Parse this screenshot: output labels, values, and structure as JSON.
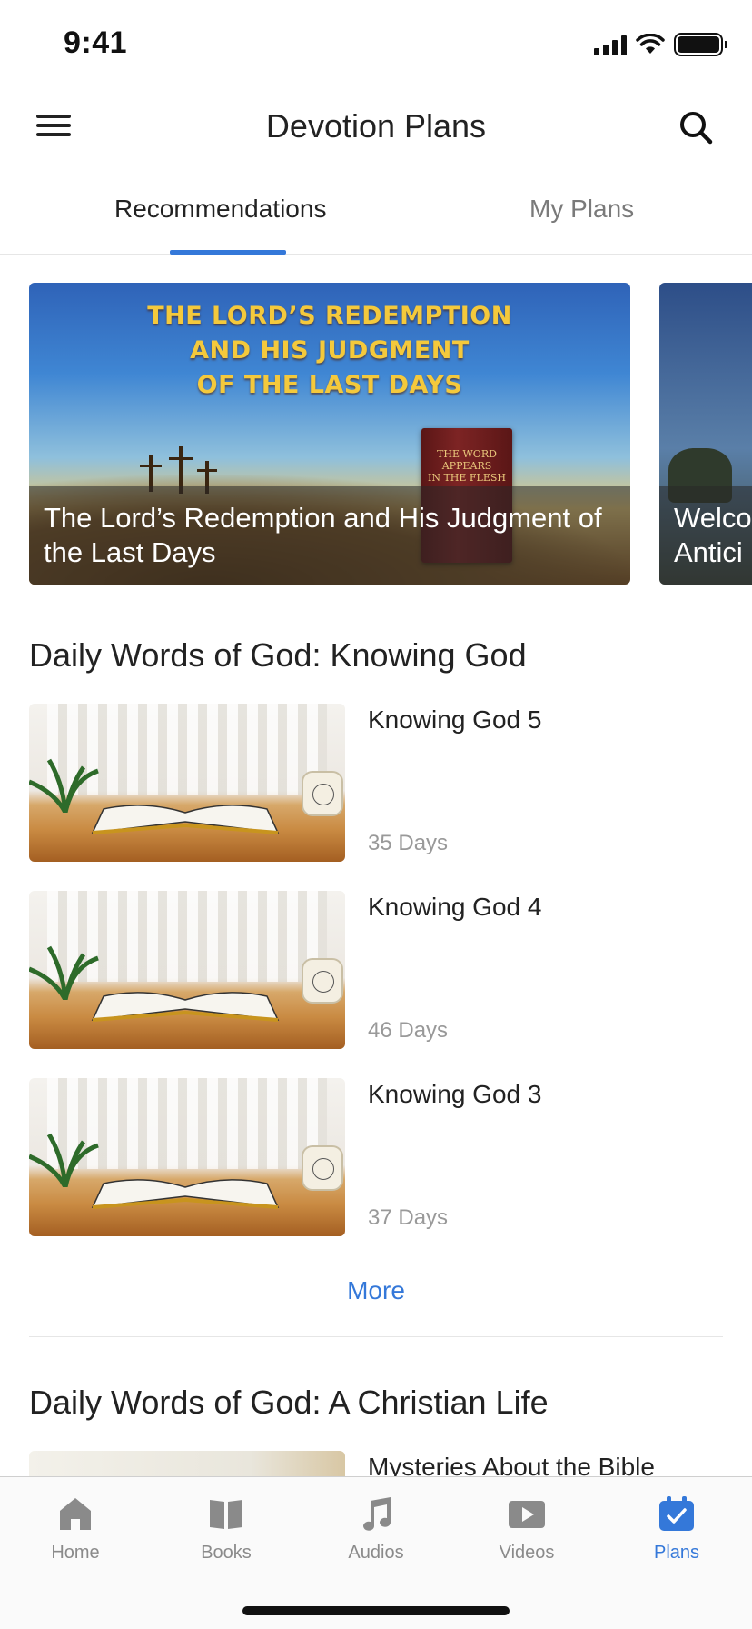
{
  "status_bar": {
    "time": "9:41"
  },
  "header": {
    "title": "Devotion Plans"
  },
  "tabs": [
    {
      "label": "Recommendations",
      "active": true
    },
    {
      "label": "My Plans",
      "active": false
    }
  ],
  "carousel": [
    {
      "headline": "THE LORD'S REDEMPTION\nAND HIS JUDGMENT\nOF THE LAST DAYS",
      "book_text": "THE WORD\nAPPEARS\nIN THE FLESH",
      "caption": "The Lord’s Redemption and His Judgment of the Last Days"
    },
    {
      "caption": "Welco\nAntici"
    }
  ],
  "sections": [
    {
      "title": "Daily Words of God: Knowing God",
      "plans": [
        {
          "title": "Knowing God 5",
          "days": "35 Days"
        },
        {
          "title": "Knowing God 4",
          "days": "46 Days"
        },
        {
          "title": "Knowing God 3",
          "days": "37 Days"
        }
      ],
      "more_label": "More"
    },
    {
      "title": "Daily Words of God:  A Christian Life",
      "plans": [
        {
          "title": "Mysteries About the Bible"
        }
      ]
    }
  ],
  "tab_bar": [
    {
      "label": "Home",
      "icon": "home-icon",
      "active": false
    },
    {
      "label": "Books",
      "icon": "book-icon",
      "active": false
    },
    {
      "label": "Audios",
      "icon": "music-note-icon",
      "active": false
    },
    {
      "label": "Videos",
      "icon": "video-play-icon",
      "active": false
    },
    {
      "label": "Plans",
      "icon": "calendar-check-icon",
      "active": true
    }
  ],
  "colors": {
    "accent": "#3478d9",
    "inactive": "#8a8a8a",
    "text": "#222222"
  }
}
